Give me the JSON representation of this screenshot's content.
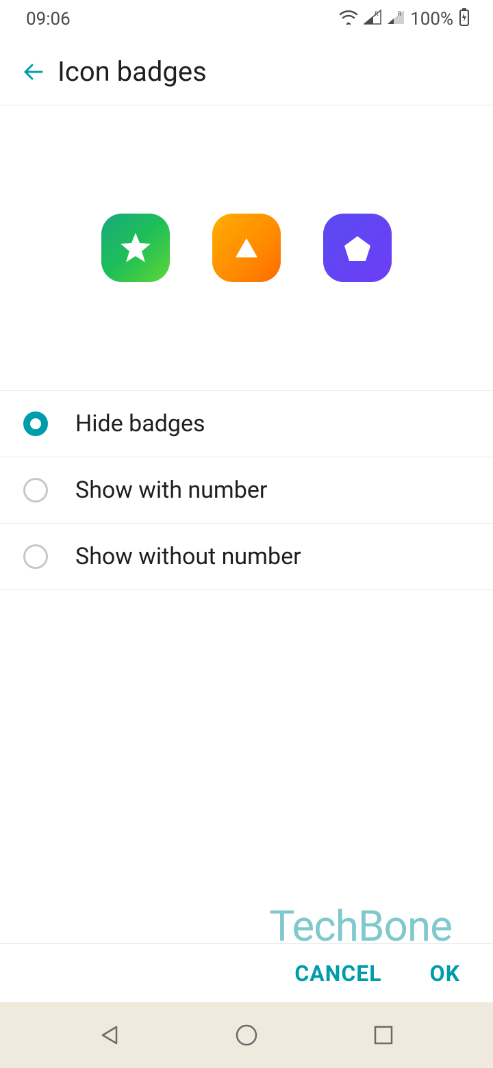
{
  "status": {
    "time": "09:06",
    "battery_pct": "100%"
  },
  "header": {
    "title": "Icon badges"
  },
  "options": [
    {
      "label": "Hide badges",
      "selected": true
    },
    {
      "label": "Show with number",
      "selected": false
    },
    {
      "label": "Show without number",
      "selected": false
    }
  ],
  "buttons": {
    "cancel": "CANCEL",
    "ok": "OK"
  },
  "watermark": "TechBone"
}
